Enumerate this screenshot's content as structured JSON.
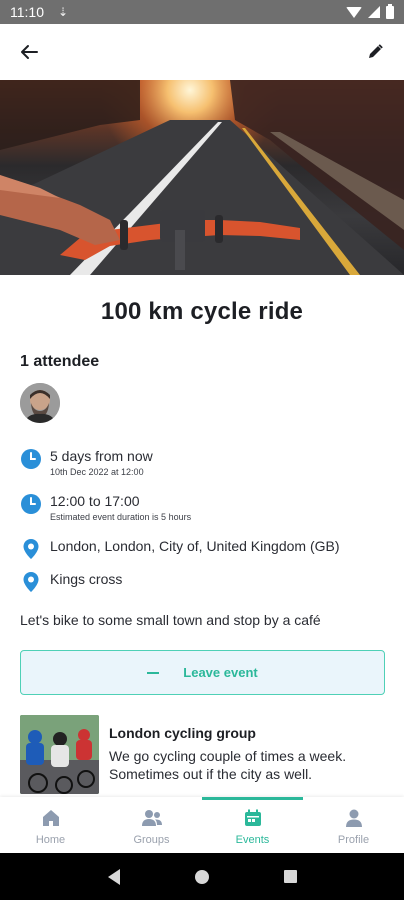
{
  "status_bar": {
    "time": "11:10"
  },
  "event": {
    "title": "100 km cycle ride",
    "attendees_heading": "1 attendee",
    "date_relative": "5 days from now",
    "date_exact": "10th Dec 2022 at 12:00",
    "time_range": "12:00 to 17:00",
    "duration_note": "Estimated event duration is 5 hours",
    "location": "London, London, City of, United Kingdom (GB)",
    "meeting_point": "Kings cross",
    "description": "Let's bike to some small town and stop by a café"
  },
  "actions": {
    "leave_label": "Leave event"
  },
  "group": {
    "name": "London cycling group",
    "description": "We go cycling couple of times a week. Sometimes out if the city as well."
  },
  "bottom_nav": {
    "items": [
      {
        "label": "Home",
        "icon": "home-icon"
      },
      {
        "label": "Groups",
        "icon": "groups-icon"
      },
      {
        "label": "Events",
        "icon": "calendar-icon",
        "active": true
      },
      {
        "label": "Profile",
        "icon": "profile-icon"
      }
    ]
  },
  "colors": {
    "accent": "#2bb89a",
    "info_icon": "#2a8fd8",
    "button_bg": "#eaf5fb"
  }
}
